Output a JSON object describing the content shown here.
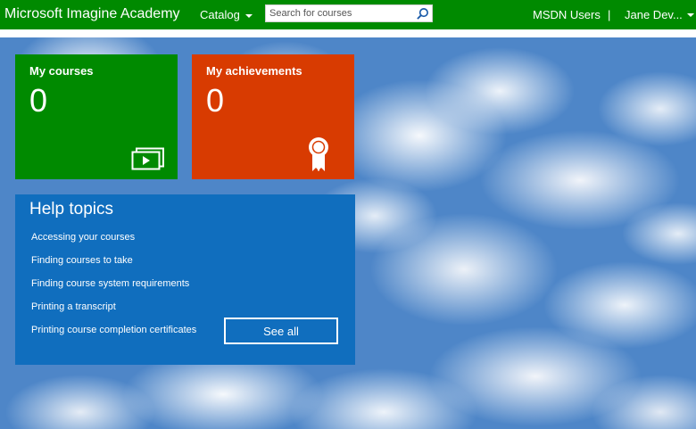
{
  "header": {
    "brand": "Microsoft Imagine Academy",
    "catalog_label": "Catalog",
    "search_placeholder": "Search for courses",
    "org_label": "MSDN Users",
    "separator": "|",
    "user_label": "Jane Dev..."
  },
  "tiles": {
    "courses": {
      "title": "My courses",
      "count": "0",
      "icon": "video-player-icon"
    },
    "achievements": {
      "title": "My achievements",
      "count": "0",
      "icon": "award-ribbon-icon"
    }
  },
  "help": {
    "title": "Help topics",
    "links": [
      "Accessing your courses",
      "Finding courses to take",
      "Finding course system requirements",
      "Printing a transcript",
      "Printing course completion certificates"
    ],
    "see_all_label": "See all"
  },
  "colors": {
    "header_green": "#008a00",
    "courses_green": "#008a00",
    "achievements_orange": "#d83b01",
    "help_blue": "#106ebe"
  }
}
